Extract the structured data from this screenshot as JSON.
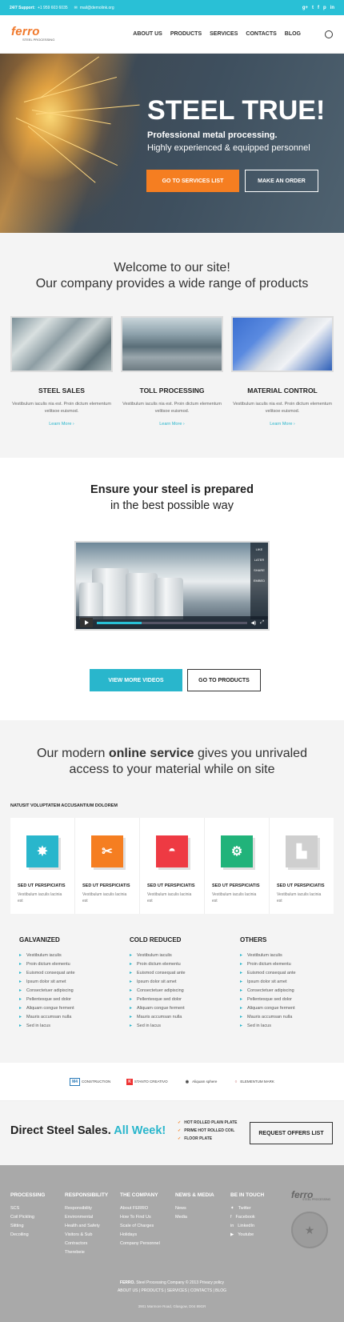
{
  "topbar": {
    "support": "24/7 Support:",
    "phone": "+1 959 603 6035",
    "email": "mail@demolink.org",
    "social": [
      "g+",
      "t",
      "f",
      "p",
      "in"
    ]
  },
  "header": {
    "logo": "ferro",
    "logo_sub": "STEEL PROCESSING",
    "nav": [
      "ABOUT US",
      "PRODUCTS",
      "SERVICES",
      "CONTACTS",
      "BLOG"
    ]
  },
  "hero": {
    "title": "STEEL TRUE!",
    "subtitle": "Professional metal processing.",
    "subtitle2": "Highly experienced & equipped personnel",
    "btn1": "GO TO SERVICES LIST",
    "btn2": "MAKE AN ORDER"
  },
  "welcome": {
    "line1": "Welcome to our site!",
    "line2": "Our company provides a wide range of products",
    "cards": [
      {
        "title": "STEEL SALES",
        "desc": "Vestibulum iaculis nia est. Proin dictum elementum velitsoe euismod.",
        "link": "Learn More ›"
      },
      {
        "title": "TOLL PROCESSING",
        "desc": "Vestibulum iaculis nia est. Proin dictum elementum velitsoe euismod.",
        "link": "Learn More ›"
      },
      {
        "title": "MATERIAL CONTROL",
        "desc": "Vestibulum iaculis nia est. Proin dictum elementum velitsoe euismod.",
        "link": "Learn More ›"
      }
    ]
  },
  "ensure": {
    "line1": "Ensure your steel is prepared",
    "line2": "in the best possible way",
    "btn1": "VIEW MORE VIDEOS",
    "btn2": "GO TO PRODUCTS",
    "video_side": [
      "LIKE",
      "LATER",
      "SHARE",
      "EMBED"
    ]
  },
  "online": {
    "pre": "Our modern ",
    "bold": "online service",
    "post": " gives you unrivaled",
    "line2": "access to your material while on site",
    "section": "NATUSIT VOLUPTATEM ACCUSANTIUM DOLOREM",
    "tiles": [
      {
        "title": "SED UT PERSPICIATIS",
        "desc": "Vestibulum iaculis lacinia est",
        "color": "#29b6cc",
        "icon": "gear-icon"
      },
      {
        "title": "SED UT PERSPICIATIS",
        "desc": "Vestibulum iaculis lacinia est",
        "color": "#f57e21",
        "icon": "pliers-icon"
      },
      {
        "title": "SED UT PERSPICIATIS",
        "desc": "Vestibulum iaculis lacinia est",
        "color": "#ee3a43",
        "icon": "helmet-icon"
      },
      {
        "title": "SED UT PERSPICIATIS",
        "desc": "Vestibulum iaculis lacinia est",
        "color": "#21b37a",
        "icon": "toolbox-icon"
      },
      {
        "title": "SED UT PERSPICIATIS",
        "desc": "Vestibulum iaculis lacinia est",
        "color": "#cfcfcf",
        "icon": "factory-icon"
      }
    ],
    "columns": [
      {
        "title": "GALVANIZED",
        "items": [
          "Vestibulum iaculis",
          "Proin dictum elementu",
          "Euismod consequat ante",
          "Ipsum dolor sit amet",
          "Consectetuer adipiscing",
          "Pellentesque sed dolor",
          "Aliquam congue ferment",
          "Mauris accumsan nulla",
          "Sed in lacus"
        ]
      },
      {
        "title": "COLD REDUCED",
        "items": [
          "Vestibulum iaculis",
          "Proin dictum elementu",
          "Euismod consequat ante",
          "Ipsum dolor sit amet",
          "Consectetuer adipiscing",
          "Pellentesque sed dolor",
          "Aliquam congue ferment",
          "Mauris accumsan nulla",
          "Sed in lacus"
        ]
      },
      {
        "title": "OTHERS",
        "items": [
          "Vestibulum iaculis",
          "Proin dictum elementu",
          "Euismod consequat ante",
          "Ipsum dolor sit amet",
          "Consectetuer adipiscing",
          "Pellentesque sed dolor",
          "Aliquam congue ferment",
          "Mauris accumsan nulla",
          "Sed in lacus"
        ]
      }
    ]
  },
  "brands": [
    {
      "mark": "M4",
      "name": "CONSTRUCTION"
    },
    {
      "mark": "K",
      "name": "STANTO CREATIVO"
    },
    {
      "mark": "◉",
      "name": "Aliquam sphere"
    },
    {
      "mark": "○",
      "name": "ELEMENTUM MARK"
    }
  ],
  "direct": {
    "title": "Direct Steel Sales.",
    "highlight": "All Week!",
    "items": [
      "HOT ROLLED PLAIN PLATE",
      "PRIME HOT ROLLED COIL",
      "FLOOR PLATE"
    ],
    "btn": "REQUEST OFFERS LIST"
  },
  "footer": {
    "columns": [
      {
        "title": "PROCESSING",
        "items": [
          "SCS",
          "Coil Pickling",
          "Slitting",
          "Decoiling"
        ]
      },
      {
        "title": "RESPONSIBILITY",
        "items": [
          "Responsibility",
          "Environmental",
          "Health and Safety",
          "Visitors & Sub",
          "Contractors",
          "Therebeie"
        ]
      },
      {
        "title": "THE COMPANY",
        "items": [
          "About FERRO",
          "How To Find Us",
          "Scale of Charges",
          "Holidays",
          "Company Personnel"
        ]
      },
      {
        "title": "NEWS & MEDIA",
        "items": [
          "News",
          "Media"
        ]
      },
      {
        "title": "BE IN TOUCH",
        "items": [
          "Twitter",
          "Facebook",
          "LinkedIn",
          "Youtube"
        ]
      }
    ],
    "logo": "ferro",
    "logo_sub": "STEEL PROCESSING",
    "copyright_brand": "FERRO.",
    "copyright": "Steel Processing Company © 2013 Privacy policy",
    "links": "ABOUT US | PRODUCTS | SERVICES | CONTACTS | BLOG",
    "address": "3901 Marmore Road, Glasgow, D04 89GR"
  }
}
